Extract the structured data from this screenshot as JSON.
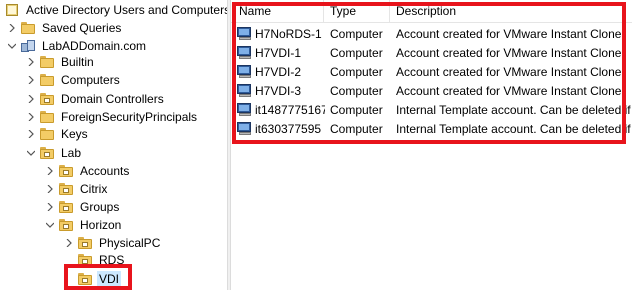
{
  "tree": {
    "root": "Active Directory Users and Computers",
    "saved_queries": "Saved Queries",
    "domain": "LabADDomain.com",
    "items": {
      "builtin": "Builtin",
      "computers": "Computers",
      "domain_controllers": "Domain Controllers",
      "foreign_security_principals": "ForeignSecurityPrincipals",
      "keys": "Keys",
      "lab": "Lab",
      "accounts": "Accounts",
      "citrix": "Citrix",
      "groups": "Groups",
      "horizon": "Horizon",
      "physicalpc": "PhysicalPC",
      "rds": "RDS",
      "vdi": "VDI"
    }
  },
  "list": {
    "columns": [
      "Name",
      "Type",
      "Description"
    ],
    "rows": [
      {
        "name": "H7NoRDS-1",
        "type": "Computer",
        "description": "Account created for VMware Instant Clone"
      },
      {
        "name": "H7VDI-1",
        "type": "Computer",
        "description": "Account created for VMware Instant Clone"
      },
      {
        "name": "H7VDI-2",
        "type": "Computer",
        "description": "Account created for VMware Instant Clone"
      },
      {
        "name": "H7VDI-3",
        "type": "Computer",
        "description": "Account created for VMware Instant Clone"
      },
      {
        "name": "it1487775167",
        "type": "Computer",
        "description": "Internal Template account. Can be deleted if"
      },
      {
        "name": "it630377595",
        "type": "Computer",
        "description": "Internal Template account. Can be deleted if"
      }
    ]
  },
  "colors": {
    "highlight": "#e8141c",
    "selection": "#cce8ff"
  }
}
